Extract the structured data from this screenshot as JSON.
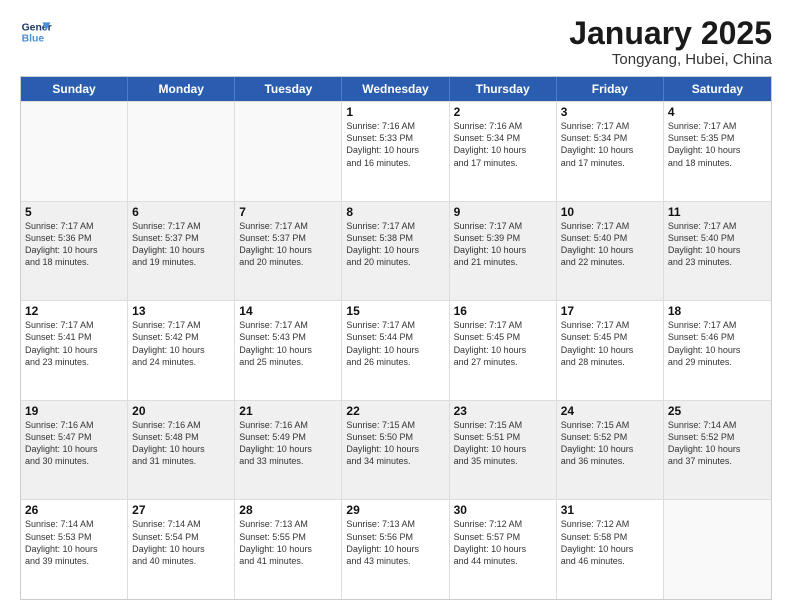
{
  "logo": {
    "line1": "General",
    "line2": "Blue"
  },
  "title": "January 2025",
  "subtitle": "Tongyang, Hubei, China",
  "days": [
    "Sunday",
    "Monday",
    "Tuesday",
    "Wednesday",
    "Thursday",
    "Friday",
    "Saturday"
  ],
  "rows": [
    [
      {
        "day": "",
        "empty": true
      },
      {
        "day": "",
        "empty": true
      },
      {
        "day": "",
        "empty": true
      },
      {
        "day": "1",
        "lines": [
          "Sunrise: 7:16 AM",
          "Sunset: 5:33 PM",
          "Daylight: 10 hours",
          "and 16 minutes."
        ]
      },
      {
        "day": "2",
        "lines": [
          "Sunrise: 7:16 AM",
          "Sunset: 5:34 PM",
          "Daylight: 10 hours",
          "and 17 minutes."
        ]
      },
      {
        "day": "3",
        "lines": [
          "Sunrise: 7:17 AM",
          "Sunset: 5:34 PM",
          "Daylight: 10 hours",
          "and 17 minutes."
        ]
      },
      {
        "day": "4",
        "lines": [
          "Sunrise: 7:17 AM",
          "Sunset: 5:35 PM",
          "Daylight: 10 hours",
          "and 18 minutes."
        ]
      }
    ],
    [
      {
        "day": "5",
        "lines": [
          "Sunrise: 7:17 AM",
          "Sunset: 5:36 PM",
          "Daylight: 10 hours",
          "and 18 minutes."
        ]
      },
      {
        "day": "6",
        "lines": [
          "Sunrise: 7:17 AM",
          "Sunset: 5:37 PM",
          "Daylight: 10 hours",
          "and 19 minutes."
        ]
      },
      {
        "day": "7",
        "lines": [
          "Sunrise: 7:17 AM",
          "Sunset: 5:37 PM",
          "Daylight: 10 hours",
          "and 20 minutes."
        ]
      },
      {
        "day": "8",
        "lines": [
          "Sunrise: 7:17 AM",
          "Sunset: 5:38 PM",
          "Daylight: 10 hours",
          "and 20 minutes."
        ]
      },
      {
        "day": "9",
        "lines": [
          "Sunrise: 7:17 AM",
          "Sunset: 5:39 PM",
          "Daylight: 10 hours",
          "and 21 minutes."
        ]
      },
      {
        "day": "10",
        "lines": [
          "Sunrise: 7:17 AM",
          "Sunset: 5:40 PM",
          "Daylight: 10 hours",
          "and 22 minutes."
        ]
      },
      {
        "day": "11",
        "lines": [
          "Sunrise: 7:17 AM",
          "Sunset: 5:40 PM",
          "Daylight: 10 hours",
          "and 23 minutes."
        ]
      }
    ],
    [
      {
        "day": "12",
        "lines": [
          "Sunrise: 7:17 AM",
          "Sunset: 5:41 PM",
          "Daylight: 10 hours",
          "and 23 minutes."
        ]
      },
      {
        "day": "13",
        "lines": [
          "Sunrise: 7:17 AM",
          "Sunset: 5:42 PM",
          "Daylight: 10 hours",
          "and 24 minutes."
        ]
      },
      {
        "day": "14",
        "lines": [
          "Sunrise: 7:17 AM",
          "Sunset: 5:43 PM",
          "Daylight: 10 hours",
          "and 25 minutes."
        ]
      },
      {
        "day": "15",
        "lines": [
          "Sunrise: 7:17 AM",
          "Sunset: 5:44 PM",
          "Daylight: 10 hours",
          "and 26 minutes."
        ]
      },
      {
        "day": "16",
        "lines": [
          "Sunrise: 7:17 AM",
          "Sunset: 5:45 PM",
          "Daylight: 10 hours",
          "and 27 minutes."
        ]
      },
      {
        "day": "17",
        "lines": [
          "Sunrise: 7:17 AM",
          "Sunset: 5:45 PM",
          "Daylight: 10 hours",
          "and 28 minutes."
        ]
      },
      {
        "day": "18",
        "lines": [
          "Sunrise: 7:17 AM",
          "Sunset: 5:46 PM",
          "Daylight: 10 hours",
          "and 29 minutes."
        ]
      }
    ],
    [
      {
        "day": "19",
        "lines": [
          "Sunrise: 7:16 AM",
          "Sunset: 5:47 PM",
          "Daylight: 10 hours",
          "and 30 minutes."
        ]
      },
      {
        "day": "20",
        "lines": [
          "Sunrise: 7:16 AM",
          "Sunset: 5:48 PM",
          "Daylight: 10 hours",
          "and 31 minutes."
        ]
      },
      {
        "day": "21",
        "lines": [
          "Sunrise: 7:16 AM",
          "Sunset: 5:49 PM",
          "Daylight: 10 hours",
          "and 33 minutes."
        ]
      },
      {
        "day": "22",
        "lines": [
          "Sunrise: 7:15 AM",
          "Sunset: 5:50 PM",
          "Daylight: 10 hours",
          "and 34 minutes."
        ]
      },
      {
        "day": "23",
        "lines": [
          "Sunrise: 7:15 AM",
          "Sunset: 5:51 PM",
          "Daylight: 10 hours",
          "and 35 minutes."
        ]
      },
      {
        "day": "24",
        "lines": [
          "Sunrise: 7:15 AM",
          "Sunset: 5:52 PM",
          "Daylight: 10 hours",
          "and 36 minutes."
        ]
      },
      {
        "day": "25",
        "lines": [
          "Sunrise: 7:14 AM",
          "Sunset: 5:52 PM",
          "Daylight: 10 hours",
          "and 37 minutes."
        ]
      }
    ],
    [
      {
        "day": "26",
        "lines": [
          "Sunrise: 7:14 AM",
          "Sunset: 5:53 PM",
          "Daylight: 10 hours",
          "and 39 minutes."
        ]
      },
      {
        "day": "27",
        "lines": [
          "Sunrise: 7:14 AM",
          "Sunset: 5:54 PM",
          "Daylight: 10 hours",
          "and 40 minutes."
        ]
      },
      {
        "day": "28",
        "lines": [
          "Sunrise: 7:13 AM",
          "Sunset: 5:55 PM",
          "Daylight: 10 hours",
          "and 41 minutes."
        ]
      },
      {
        "day": "29",
        "lines": [
          "Sunrise: 7:13 AM",
          "Sunset: 5:56 PM",
          "Daylight: 10 hours",
          "and 43 minutes."
        ]
      },
      {
        "day": "30",
        "lines": [
          "Sunrise: 7:12 AM",
          "Sunset: 5:57 PM",
          "Daylight: 10 hours",
          "and 44 minutes."
        ]
      },
      {
        "day": "31",
        "lines": [
          "Sunrise: 7:12 AM",
          "Sunset: 5:58 PM",
          "Daylight: 10 hours",
          "and 46 minutes."
        ]
      },
      {
        "day": "",
        "empty": true
      }
    ]
  ]
}
